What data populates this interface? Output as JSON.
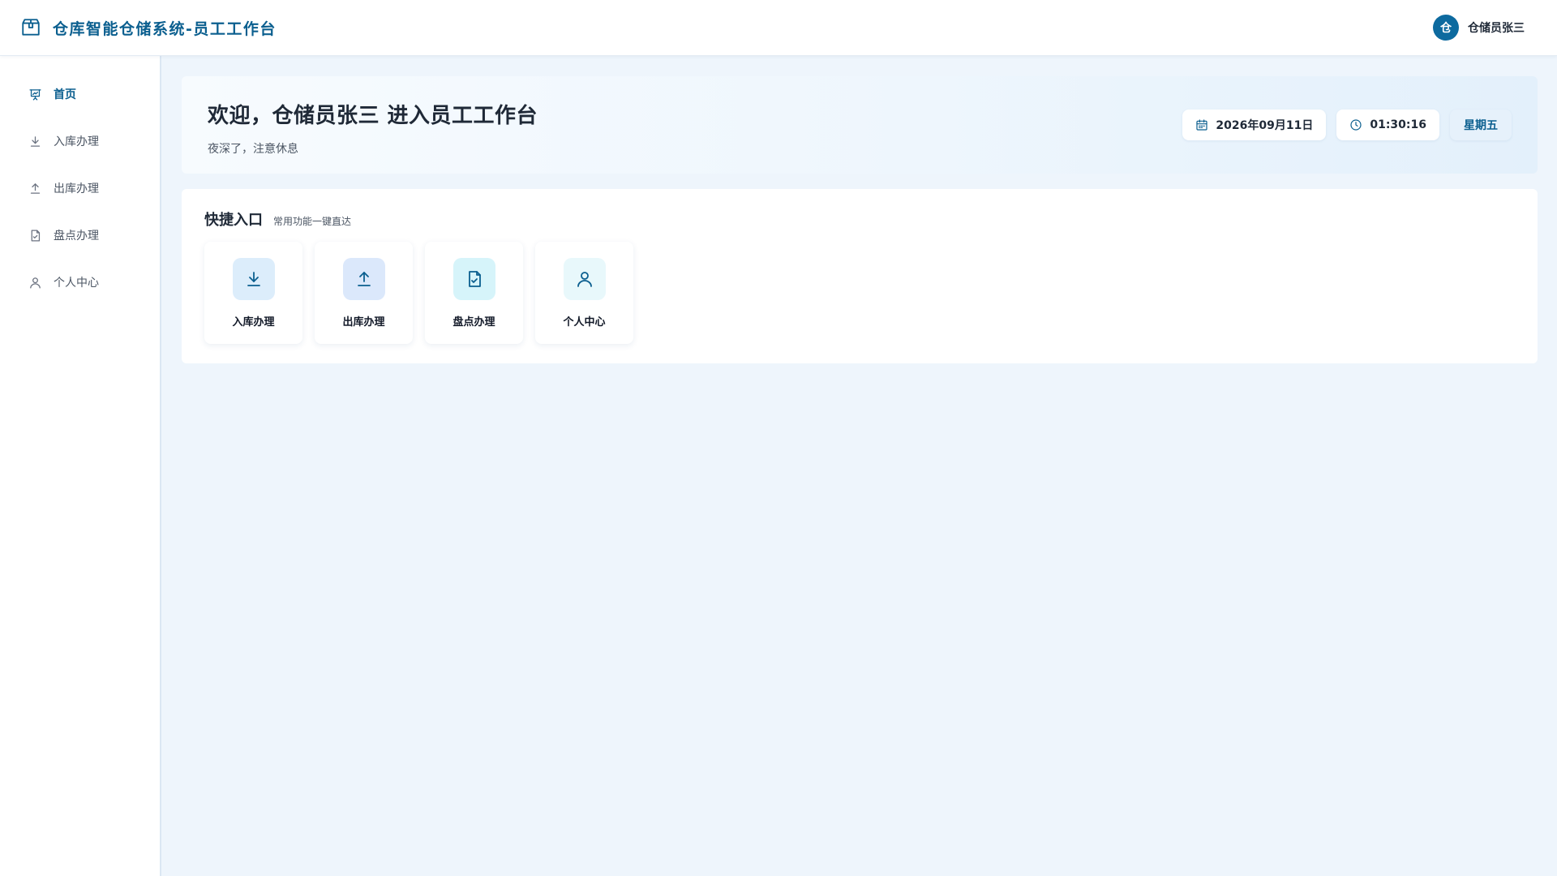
{
  "header": {
    "title": "仓库智能仓储系统-员工工作台",
    "brand_icon": "warehouse-box-icon",
    "avatar_text": "仓",
    "user_name": "仓储员张三",
    "accent_color": "#0b5f8f"
  },
  "sidebar": {
    "items": [
      {
        "label": "首页",
        "icon": "dashboard-icon",
        "active": true
      },
      {
        "label": "入库办理",
        "icon": "download-icon",
        "active": false
      },
      {
        "label": "出库办理",
        "icon": "upload-icon",
        "active": false
      },
      {
        "label": "盘点办理",
        "icon": "file-check-icon",
        "active": false
      },
      {
        "label": "个人中心",
        "icon": "user-icon",
        "active": false
      }
    ]
  },
  "welcome": {
    "title": "欢迎，仓储员张三 进入员工工作台",
    "subtitle": "夜深了，注意休息",
    "date": "2026年09月11日",
    "time": "01:30:16",
    "weekday": "星期五"
  },
  "quick": {
    "title": "快捷入口",
    "subtitle": "常用功能一键直达",
    "tiles": [
      {
        "label": "入库办理",
        "icon": "download-icon",
        "bg": "#dcedfb"
      },
      {
        "label": "出库办理",
        "icon": "upload-icon",
        "bg": "#dbe8fb"
      },
      {
        "label": "盘点办理",
        "icon": "file-check-icon",
        "bg": "#d6f4fa"
      },
      {
        "label": "个人中心",
        "icon": "user-icon",
        "bg": "#e8f8fb"
      }
    ]
  }
}
